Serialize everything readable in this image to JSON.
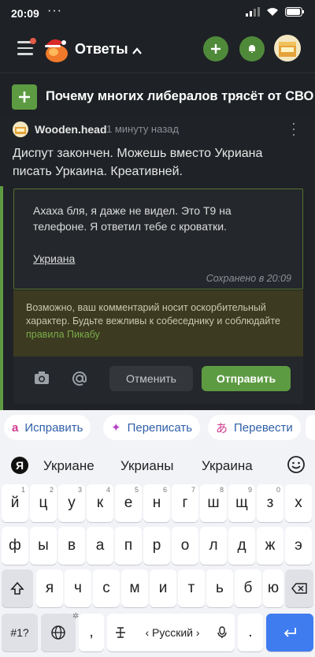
{
  "status_bar": {
    "time": "20:09",
    "dots": "···"
  },
  "header": {
    "title": "Ответы",
    "chevron": "^"
  },
  "post": {
    "title": "Почему многих либералов трясёт от СВО"
  },
  "comment": {
    "author": "Wooden.head",
    "time": "1 минуту назад",
    "text": "Диспут закончен. Можешь вместо Укриана писать Уркаина. Креативней.",
    "reply": {
      "text": "Ахаха бля, я даже не видел. Это Т9 на телефоне. Я ответил тебе с кроватки.",
      "word": "Укриана",
      "saved": "Сохранено в 20:09"
    },
    "warning": {
      "text": "Возможно, ваш комментарий носит оскорбительный характер. Будьте вежливы к собеседнику и соблюдайте",
      "link": "правила Пикабу"
    },
    "buttons": {
      "cancel": "Отменить",
      "send": "Отправить"
    }
  },
  "keyboard": {
    "chips": [
      {
        "label": "Исправить",
        "icon": "a"
      },
      {
        "label": "Переписать",
        "icon": "✦"
      },
      {
        "label": "Перевести",
        "icon": "あ"
      }
    ],
    "yandex_badge": "Я",
    "suggestions": [
      "Укриане",
      "Укрианы",
      "Украина"
    ],
    "row1": [
      {
        "k": "й",
        "n": "1"
      },
      {
        "k": "ц",
        "n": "2"
      },
      {
        "k": "у",
        "n": "3"
      },
      {
        "k": "к",
        "n": "4"
      },
      {
        "k": "е",
        "n": "5"
      },
      {
        "k": "н",
        "n": "6"
      },
      {
        "k": "г",
        "n": "7"
      },
      {
        "k": "ш",
        "n": "8"
      },
      {
        "k": "щ",
        "n": "9"
      },
      {
        "k": "з",
        "n": "0"
      },
      {
        "k": "х",
        "n": ""
      }
    ],
    "row2": [
      "ф",
      "ы",
      "в",
      "а",
      "п",
      "р",
      "о",
      "л",
      "д",
      "ж",
      "э"
    ],
    "row3": [
      "я",
      "ч",
      "с",
      "м",
      "и",
      "т",
      "ь",
      "б",
      "ю"
    ],
    "row4": {
      "symbols": "#1?",
      "comma": ",",
      "space": "‹ Русский ›",
      "period": "."
    }
  },
  "colors": {
    "accent": "#5d9b43",
    "enter": "#3f7cf0",
    "warning_bg": "#3c3a20"
  }
}
